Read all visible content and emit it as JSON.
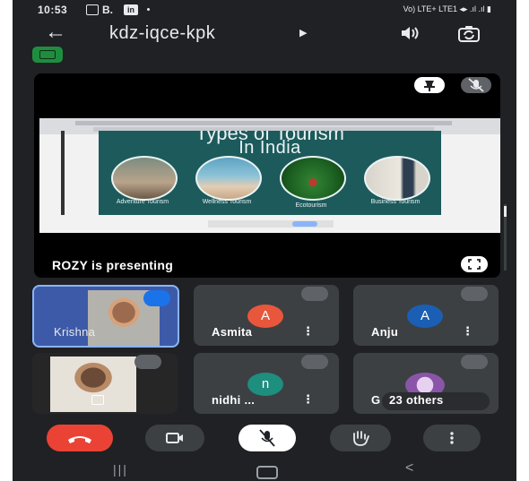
{
  "status": {
    "time": "10:53",
    "notif_b": "B.",
    "notif_in": "in",
    "network": "Vo) LTE+ LTE1 ◂▸  .ıl .ıl  ▮"
  },
  "meeting": {
    "code": "kdz-iqce-kpk"
  },
  "presentation": {
    "presenter_text": "ROZY is presenting",
    "slide_header": "Types of Tourism",
    "slide_title": "In India",
    "captions": [
      "Adventure Tourism",
      "Wellness Tourism",
      "Ecotourism",
      "Business Tourism"
    ]
  },
  "participants": [
    {
      "name": "Krishna",
      "type": "video"
    },
    {
      "name": "Asmita",
      "initial": "A",
      "color": "#e8573b"
    },
    {
      "name": "Anju",
      "initial": "A",
      "color": "#1a5fb4"
    },
    {
      "name": "",
      "type": "video"
    },
    {
      "name": "nidhi ...",
      "initial": "n",
      "color": "#1e8e7e"
    },
    {
      "name": "23 others",
      "prefix": "G"
    }
  ],
  "icons": [
    "back-arrow-icon",
    "dropdown-caret-icon",
    "speaker-icon",
    "switch-camera-icon",
    "pin-icon",
    "mic-off-icon",
    "fullscreen-icon",
    "end-call-icon",
    "camera-icon",
    "raise-hand-icon",
    "more-icon"
  ],
  "colors": {
    "end_call": "#ea4335",
    "dark_bg": "#202124",
    "tile_bg": "#3c4043",
    "accent": "#1a73e8"
  }
}
